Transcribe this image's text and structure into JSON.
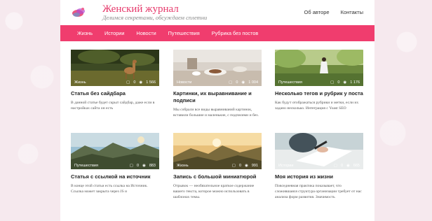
{
  "site": {
    "title": "Женский журнал",
    "tagline": "Делимся секретами, обсуждаем сплетни",
    "top_links": [
      "Об авторе",
      "Контакты"
    ]
  },
  "nav": [
    "Жизнь",
    "Истории",
    "Новости",
    "Путешествия",
    "Рубрика без постов"
  ],
  "colors": {
    "accent": "#f03d6e",
    "title": "#e6396b"
  },
  "posts": [
    {
      "category": "Жизнь",
      "comments": "0",
      "views": "1 566",
      "title": "Статья без сайдбара",
      "excerpt": "В данной статье будет скрыт сайдбар, даже если в настройках сайта он есть"
    },
    {
      "category": "Новости",
      "comments": "0",
      "views": "1 004",
      "title": "Картинки, их выравнивание и подписи",
      "excerpt": "Мы собрали все виды выравниваний картинок, вставили большие и маленькие, с подписями и без."
    },
    {
      "category": "Путешествия",
      "comments": "0",
      "views": "1 176",
      "title": "Несколько тегов и рубрик у поста",
      "excerpt": "Как будут отображаться рубрики и метки, если их задано несколько. Интеграция с Yoast SEO"
    },
    {
      "category": "Путешествия",
      "comments": "0",
      "views": "883",
      "title": "Статья с ссылкой на источник",
      "excerpt": "В конце этой статьи есть ссылка на Источник. Ссылка может закрыта через JS и"
    },
    {
      "category": "Жизнь",
      "comments": "0",
      "views": "991",
      "title": "Запись с большой миниатюрой",
      "excerpt": "Отрывок — необязательное краткое содержание вашего текста, которое можно использовать в шаблонах темы."
    },
    {
      "category": "Истории",
      "comments": "0",
      "views": "665",
      "title": "Моя история из жизни",
      "excerpt": "Повседневная практика показывает, что сложившаяся структура организации требует от нас анализа форм развития. Значимость"
    }
  ]
}
